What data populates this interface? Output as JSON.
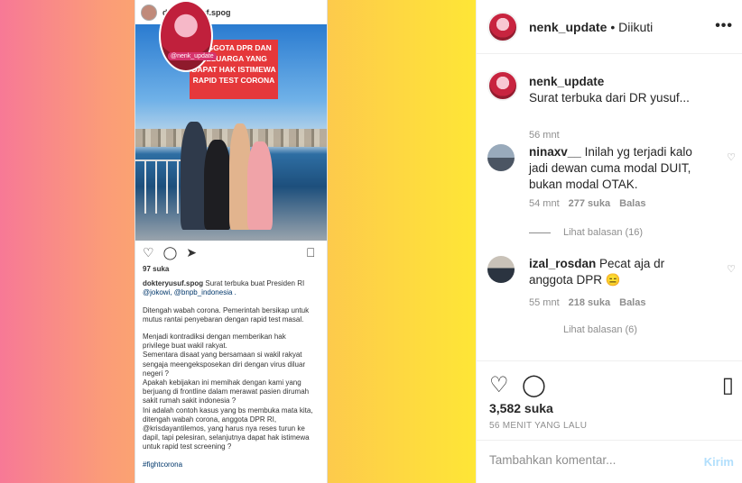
{
  "embedded_post": {
    "username": "dokteryusuf.spog",
    "banner_text": "ANGGOTA DPR DAN KELUARGA YANG DAPAT HAK ISTIMEWA RAPID TEST CORONA",
    "watermark": "@nenk_update",
    "likes": "97 suka",
    "caption_user": "dokteryusuf.spog",
    "caption_lines": [
      "Surat terbuka buat  Presiden RI",
      "@jokowi, @bnpb_indonesia ."
    ],
    "para1": "Ditengah wabah corona. Pemerintah bersikap untuk\nmutus rantai penyebaran dengan rapid test  masal.",
    "para2": "Menjadi kontradiksi  dengan memberikan hak\nprivilege buat wakil rakyat.\nSementara disaat yang bersamaan si wakil rakyat\nsengaja meengeksposekan diri dengan virus diluar\nnegeri ?\nApakah kebijakan ini memihak dengan kami yang\nberjuang di frontline dalam merawat pasien  dirumah\nsakit rumah sakit indonesia ?\nIni adalah contoh kasus yang bs membuka mata kita,\nditengah wabah corona, anggota DPR RI,\n@krisdayantilemos, yang harus nya reses turun ke\ndapil, tapi pelesiran, selanjutnya dapat hak istimewa\nuntuk rapid test screening ?",
    "hashtag": "#fightcorona"
  },
  "header": {
    "username": "nenk_update",
    "follow_status": "• Diikuti",
    "more": "•••"
  },
  "caption": {
    "username": "nenk_update",
    "text": "Surat terbuka dari DR yusuf...",
    "time": "56 mnt"
  },
  "comments": [
    {
      "username": "ninaxv__",
      "text": "Inilah yg terjadi kalo jadi dewan cuma modal DUIT, bukan modal OTAK.",
      "time": "54 mnt",
      "likes": "277 suka",
      "reply": "Balas",
      "view_replies": "Lihat balasan (16)"
    },
    {
      "username": "izal_rosdan",
      "text": "Pecat aja dr anggota DPR 😑",
      "time": "55 mnt",
      "likes": "218 suka",
      "reply": "Balas",
      "view_replies": "Lihat balasan (6)"
    }
  ],
  "actions": {
    "likes": "3,582 suka",
    "timestamp": "56 MENIT YANG LALU"
  },
  "add_comment": {
    "placeholder": "Tambahkan komentar...",
    "post_label": "Kirim"
  }
}
